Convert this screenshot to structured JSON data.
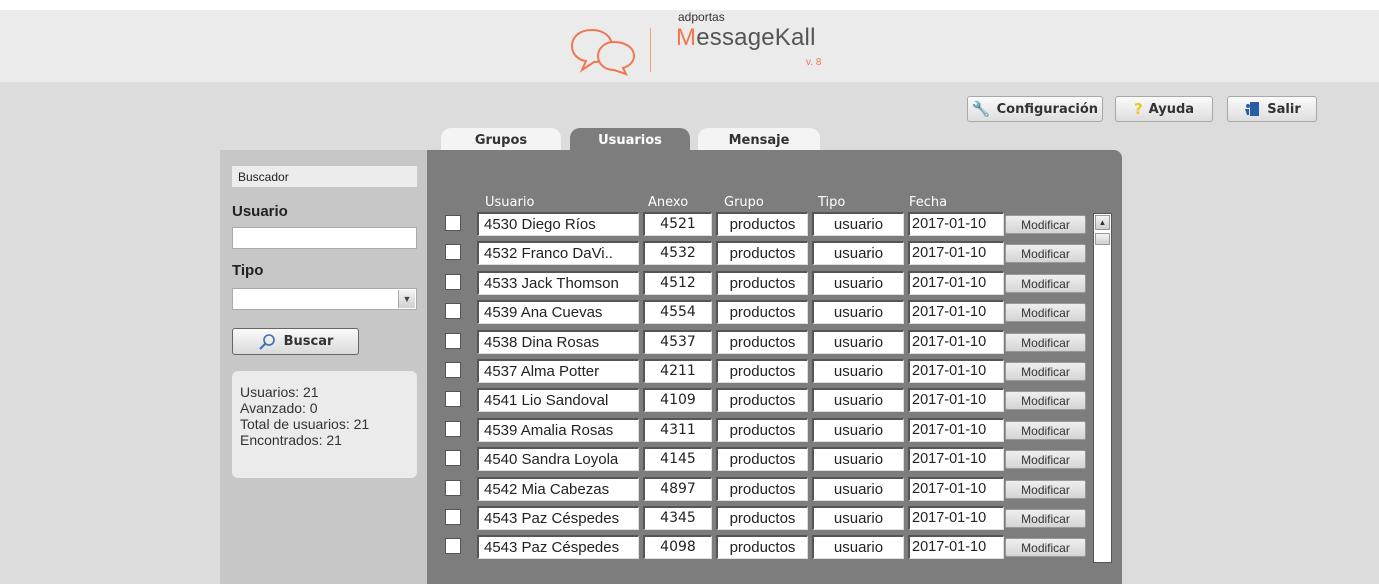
{
  "header": {
    "brand_small": "adportas",
    "brand_first_letter": "M",
    "brand_rest": "essageKall",
    "version": "v. 8"
  },
  "top_buttons": {
    "config": "Configuración",
    "help": "Ayuda",
    "logout": "Salir"
  },
  "tabs": [
    "Grupos",
    "Usuarios",
    "Mensaje"
  ],
  "sidebar": {
    "search_title": "Buscador",
    "user_label": "Usuario",
    "user_value": "",
    "type_label": "Tipo",
    "type_value": "",
    "search_button": "Buscar",
    "stats": [
      "Usuarios: 21",
      "Avanzado: 0",
      "Total de usuarios: 21",
      "Encontrados: 21"
    ]
  },
  "table": {
    "headers": [
      "Usuario",
      "Anexo",
      "Grupo",
      "Tipo",
      "Fecha"
    ],
    "modify_label": "Modificar",
    "rows": [
      {
        "usuario": "4530 Diego Ríos",
        "anexo": "4521",
        "grupo": "productos",
        "tipo": "usuario",
        "fecha": "2017-01-10"
      },
      {
        "usuario": "4532 Franco DaVi..",
        "anexo": "4532",
        "grupo": "productos",
        "tipo": "usuario",
        "fecha": "2017-01-10"
      },
      {
        "usuario": "4533 Jack Thomson",
        "anexo": "4512",
        "grupo": "productos",
        "tipo": "usuario",
        "fecha": "2017-01-10"
      },
      {
        "usuario": "4539 Ana Cuevas",
        "anexo": "4554",
        "grupo": "productos",
        "tipo": "usuario",
        "fecha": "2017-01-10"
      },
      {
        "usuario": "4538 Dina Rosas",
        "anexo": "4537",
        "grupo": "productos",
        "tipo": "usuario",
        "fecha": "2017-01-10"
      },
      {
        "usuario": "4537 Alma Potter",
        "anexo": "4211",
        "grupo": "productos",
        "tipo": "usuario",
        "fecha": "2017-01-10"
      },
      {
        "usuario": "4541 Lio Sandoval",
        "anexo": "4109",
        "grupo": "productos",
        "tipo": "usuario",
        "fecha": "2017-01-10"
      },
      {
        "usuario": "4539 Amalia Rosas",
        "anexo": "4311",
        "grupo": "productos",
        "tipo": "usuario",
        "fecha": "2017-01-10"
      },
      {
        "usuario": "4540 Sandra Loyola",
        "anexo": "4145",
        "grupo": "productos",
        "tipo": "usuario",
        "fecha": "2017-01-10"
      },
      {
        "usuario": "4542 Mia Cabezas",
        "anexo": "4897",
        "grupo": "productos",
        "tipo": "usuario",
        "fecha": "2017-01-10"
      },
      {
        "usuario": "4543 Paz Céspedes",
        "anexo": "4345",
        "grupo": "productos",
        "tipo": "usuario",
        "fecha": "2017-01-10"
      },
      {
        "usuario": "4543 Paz Céspedes",
        "anexo": "4098",
        "grupo": "productos",
        "tipo": "usuario",
        "fecha": "2017-01-10"
      }
    ]
  }
}
